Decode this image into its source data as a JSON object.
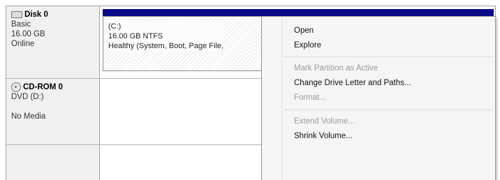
{
  "disk0": {
    "name": "Disk 0",
    "type": "Basic",
    "size": "16.00 GB",
    "status": "Online",
    "partition": {
      "letter": "(C:)",
      "size_fs": "16.00 GB NTFS",
      "status": "Healthy (System, Boot, Page File,"
    }
  },
  "cdrom0": {
    "name": "CD-ROM 0",
    "drive": "DVD (D:)",
    "media": "No Media"
  },
  "context_menu": {
    "items": [
      {
        "label": "Open",
        "enabled": true
      },
      {
        "label": "Explore",
        "enabled": true
      },
      {
        "label": "Mark Partition as Active",
        "enabled": false
      },
      {
        "label": "Change Drive Letter and Paths...",
        "enabled": true
      },
      {
        "label": "Format...",
        "enabled": false
      },
      {
        "label": "Extend Volume...",
        "enabled": false
      },
      {
        "label": "Shrink Volume...",
        "enabled": true
      }
    ]
  },
  "colors": {
    "partition_header": "#0a0a8a",
    "menu_background": "#f5f5f5",
    "disabled_text": "#9a9a9a"
  }
}
